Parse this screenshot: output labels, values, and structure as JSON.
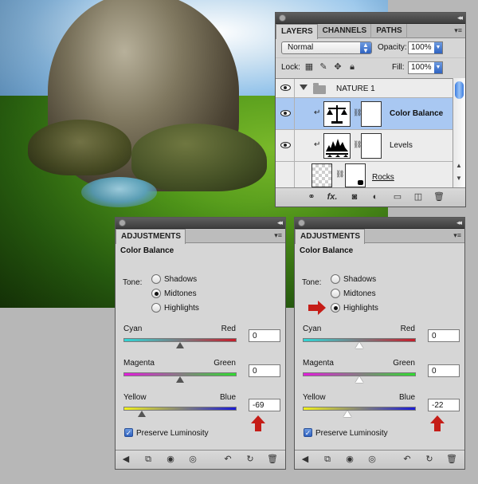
{
  "layers_panel": {
    "tabs": [
      "LAYERS",
      "CHANNELS",
      "PATHS"
    ],
    "blend_mode": "Normal",
    "opacity_label": "Opacity:",
    "opacity_value": "100%",
    "lock_label": "Lock:",
    "fill_label": "Fill:",
    "fill_value": "100%",
    "layers": [
      {
        "name": "NATURE 1",
        "type": "group"
      },
      {
        "name": "Color Balance",
        "type": "adjustment",
        "selected": true
      },
      {
        "name": "Levels",
        "type": "adjustment"
      },
      {
        "name": "Rocks",
        "type": "pixel"
      }
    ],
    "footer_icons": [
      "link-icon",
      "fx-icon",
      "mask-icon",
      "adjustment-icon",
      "folder-icon",
      "new-layer-icon",
      "trash-icon"
    ]
  },
  "adjustments_left": {
    "tab": "ADJUSTMENTS",
    "heading": "Color Balance",
    "tone_label": "Tone:",
    "tones": [
      "Shadows",
      "Midtones",
      "Highlights"
    ],
    "selected_tone": "Midtones",
    "sliders": [
      {
        "left": "Cyan",
        "right": "Red",
        "value": "0",
        "position_pct": 50
      },
      {
        "left": "Magenta",
        "right": "Green",
        "value": "0",
        "position_pct": 50
      },
      {
        "left": "Yellow",
        "right": "Blue",
        "value": "-69",
        "position_pct": 15
      }
    ],
    "preserve_label": "Preserve Luminosity"
  },
  "adjustments_right": {
    "tab": "ADJUSTMENTS",
    "heading": "Color Balance",
    "tone_label": "Tone:",
    "tones": [
      "Shadows",
      "Midtones",
      "Highlights"
    ],
    "selected_tone": "Highlights",
    "sliders": [
      {
        "left": "Cyan",
        "right": "Red",
        "value": "0",
        "position_pct": 50
      },
      {
        "left": "Magenta",
        "right": "Green",
        "value": "0",
        "position_pct": 50
      },
      {
        "left": "Yellow",
        "right": "Blue",
        "value": "-22",
        "position_pct": 39
      }
    ],
    "preserve_label": "Preserve Luminosity"
  },
  "colors": {
    "selection": "#a9c8f2",
    "panel_bg": "#d6d6d6",
    "annotation_red": "#c51d17"
  }
}
